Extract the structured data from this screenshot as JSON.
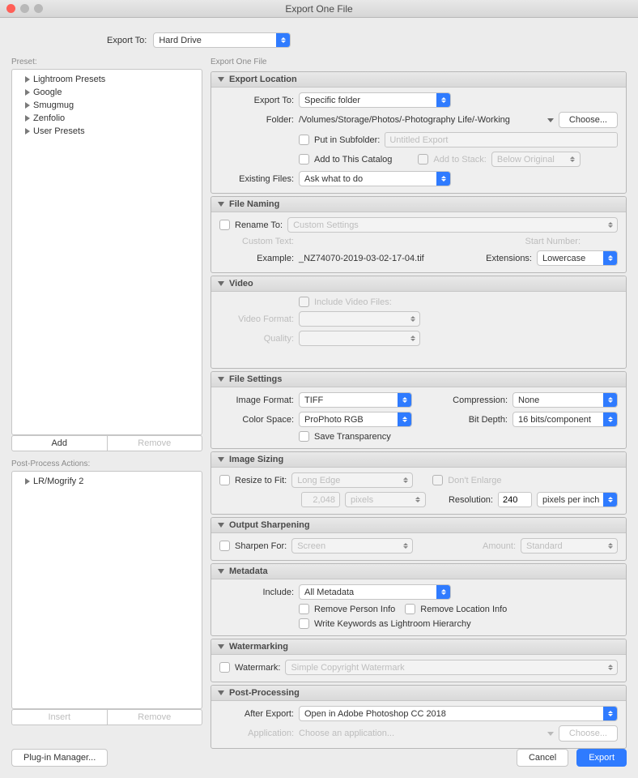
{
  "window": {
    "title": "Export One File"
  },
  "top": {
    "exportToLabel": "Export To:",
    "exportToValue": "Hard Drive"
  },
  "preset": {
    "label": "Preset:",
    "items": [
      "Lightroom Presets",
      "Google",
      "Smugmug",
      "Zenfolio",
      "User Presets"
    ],
    "add": "Add",
    "remove": "Remove"
  },
  "postProcess": {
    "label": "Post-Process Actions:",
    "items": [
      "LR/Mogrify 2"
    ],
    "insert": "Insert",
    "remove": "Remove"
  },
  "right": {
    "title": "Export One File"
  },
  "exportLocation": {
    "title": "Export Location",
    "exportToLabel": "Export To:",
    "exportToValue": "Specific folder",
    "folderLabel": "Folder:",
    "folderPath": "/Volumes/Storage/Photos/-Photography Life/-Working",
    "choose": "Choose...",
    "putSubfolder": "Put in Subfolder:",
    "subfolderPlaceholder": "Untitled Export",
    "addCatalog": "Add to This Catalog",
    "addStack": "Add to Stack:",
    "stackValue": "Below Original",
    "existingLabel": "Existing Files:",
    "existingValue": "Ask what to do"
  },
  "fileNaming": {
    "title": "File Naming",
    "renameTo": "Rename To:",
    "renameValue": "Custom Settings",
    "customText": "Custom Text:",
    "startNumber": "Start Number:",
    "exampleLabel": "Example:",
    "exampleValue": "_NZ74070-2019-03-02-17-04.tif",
    "extensionsLabel": "Extensions:",
    "extensionsValue": "Lowercase"
  },
  "video": {
    "title": "Video",
    "include": "Include Video Files:",
    "formatLabel": "Video Format:",
    "qualityLabel": "Quality:"
  },
  "fileSettings": {
    "title": "File Settings",
    "formatLabel": "Image Format:",
    "formatValue": "TIFF",
    "compressionLabel": "Compression:",
    "compressionValue": "None",
    "colorLabel": "Color Space:",
    "colorValue": "ProPhoto RGB",
    "bitLabel": "Bit Depth:",
    "bitValue": "16 bits/component",
    "transparency": "Save Transparency"
  },
  "imageSizing": {
    "title": "Image Sizing",
    "resizeLabel": "Resize to Fit:",
    "resizeValue": "Long Edge",
    "dontEnlarge": "Don't Enlarge",
    "sizeValue": "2,048",
    "sizeUnit": "pixels",
    "resolutionLabel": "Resolution:",
    "resolutionValue": "240",
    "resolutionUnit": "pixels per inch"
  },
  "outputSharpening": {
    "title": "Output Sharpening",
    "sharpenLabel": "Sharpen For:",
    "sharpenValue": "Screen",
    "amountLabel": "Amount:",
    "amountValue": "Standard"
  },
  "metadata": {
    "title": "Metadata",
    "includeLabel": "Include:",
    "includeValue": "All Metadata",
    "removePerson": "Remove Person Info",
    "removeLocation": "Remove Location Info",
    "writeKeywords": "Write Keywords as Lightroom Hierarchy"
  },
  "watermarking": {
    "title": "Watermarking",
    "label": "Watermark:",
    "value": "Simple Copyright Watermark"
  },
  "postProcessing": {
    "title": "Post-Processing",
    "afterLabel": "After Export:",
    "afterValue": "Open in Adobe Photoshop CC 2018",
    "appLabel": "Application:",
    "appPlaceholder": "Choose an application...",
    "choose": "Choose..."
  },
  "footer": {
    "plugin": "Plug-in Manager...",
    "cancel": "Cancel",
    "export": "Export"
  }
}
